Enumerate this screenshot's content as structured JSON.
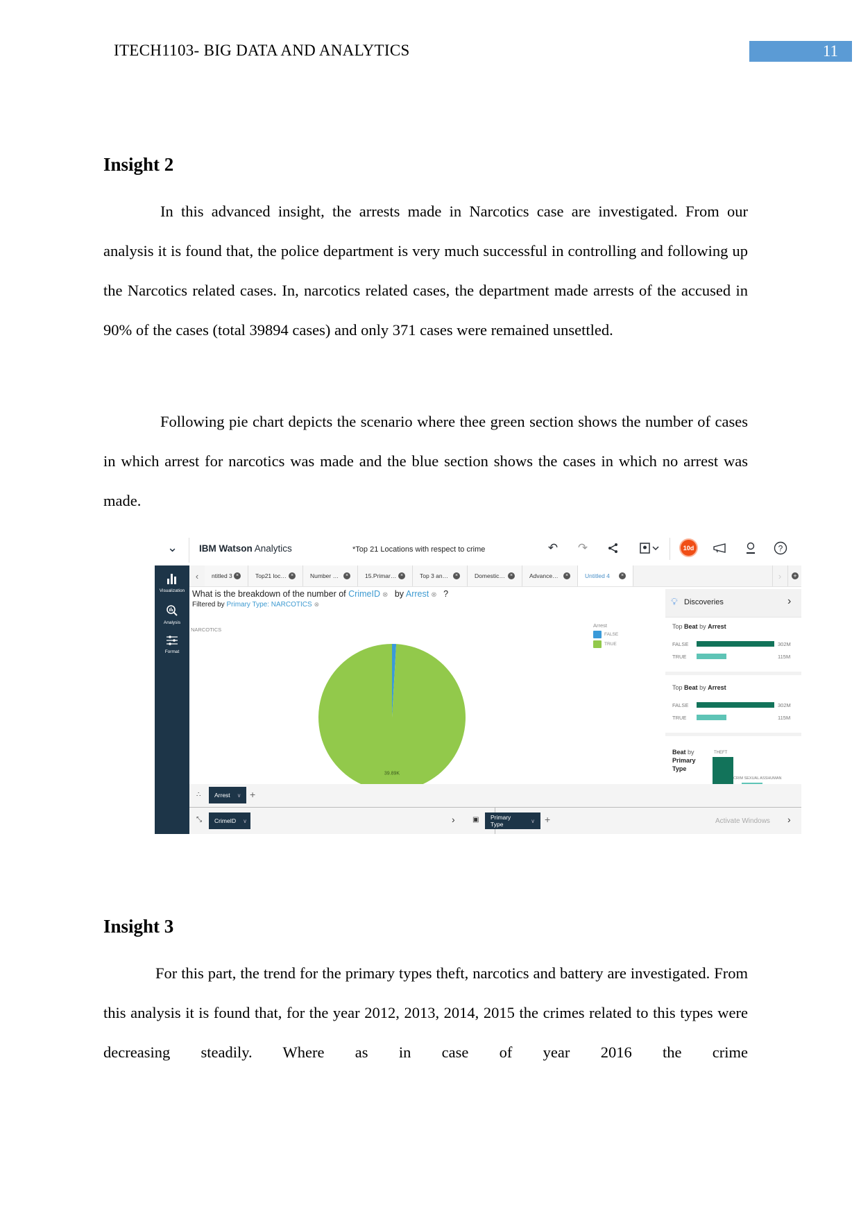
{
  "header": {
    "running_title": "ITECH1103- BIG DATA AND ANALYTICS",
    "page_number": "11"
  },
  "insight2": {
    "heading": "Insight 2",
    "paragraph1": "In this advanced insight, the arrests made in Narcotics case are investigated.   From our analysis it is found that, the police department is very much successful in controlling and following up the Narcotics related cases. In, narcotics related cases, the department made arrests of the accused in 90% of the cases (total 39894 cases) and only 371 cases were remained unsettled.",
    "paragraph2": "Following pie chart depicts the scenario where thee green section shows the number of cases in which arrest for narcotics was made and the blue section shows the cases in which no arrest was made."
  },
  "screenshot": {
    "topbar": {
      "menu_icon": "chevron-down-icon",
      "brand_bold": "IBM Watson",
      "brand_rest": " Analytics",
      "document_title": "*Top 21 Locations with respect to crime",
      "badge": "10d",
      "icons": [
        "undo-icon",
        "redo-icon",
        "share-icon",
        "screenshot-icon",
        "megaphone-icon",
        "user-icon",
        "help-icon"
      ]
    },
    "leftnav": [
      {
        "label": "Visualization",
        "icon": "bar-chart-icon"
      },
      {
        "label": "Analysis",
        "icon": "magnifier-chart-icon"
      },
      {
        "label": "Format",
        "icon": "sliders-icon"
      }
    ],
    "tabs": [
      {
        "label": "ntitled 3",
        "active": false
      },
      {
        "label": "Top21 loc…",
        "active": false
      },
      {
        "label": "Number …",
        "active": false
      },
      {
        "label": "15.Primar…",
        "active": false
      },
      {
        "label": "Top 3 an…",
        "active": false
      },
      {
        "label": "Domestic…",
        "active": false
      },
      {
        "label": "Advance…",
        "active": false
      },
      {
        "label": "Untitled 4",
        "active": true
      }
    ],
    "question": {
      "prefix": "What is the breakdown of the number of",
      "field1": "CrimeID",
      "by": "by",
      "field2": "Arrest",
      "suffix": "?"
    },
    "filter": {
      "prefix": "Filtered by",
      "value": "Primary Type: NARCOTICS"
    },
    "chart_label": "NARCOTICS",
    "legend": {
      "title": "Arrest",
      "items": [
        {
          "label": "FALSE",
          "color": "#3a9ad9"
        },
        {
          "label": "TRUE",
          "color": "#92c94b"
        }
      ]
    },
    "discoveries": {
      "title": "Discoveries",
      "cards": [
        {
          "title_pre": "Top",
          "title_b1": "Beat",
          "title_mid": "by",
          "title_b2": "Arrest",
          "rows": [
            {
              "label": "FALSE",
              "value": "302M",
              "frac": 1.0,
              "color": "#12735a"
            },
            {
              "label": "TRUE",
              "value": "115M",
              "frac": 0.38,
              "color": "#5ec4b6"
            }
          ]
        },
        {
          "title_pre": "Top",
          "title_b1": "Beat",
          "title_mid": "by",
          "title_b2": "Arrest",
          "rows": [
            {
              "label": "FALSE",
              "value": "302M",
              "frac": 1.0,
              "color": "#12735a"
            },
            {
              "label": "TRUE",
              "value": "115M",
              "frac": 0.38,
              "color": "#5ec4b6"
            }
          ]
        }
      ],
      "card3": {
        "title_b1": "Beat",
        "title_mid": "by",
        "title_b2": "Primary Type",
        "bars": [
          {
            "label": "THEFT",
            "color": "#12735a"
          },
          {
            "label": "CRIM SEXUAL ASS",
            "color": "#5ec4b6"
          },
          {
            "label": "HUMAN",
            "color": "#b5e3db"
          }
        ]
      }
    },
    "shelves": {
      "color_pill": "Arrest",
      "size_pill": "CrimeID",
      "repeat_pill": "Primary Type",
      "watermark": "Activate Windows"
    }
  },
  "chart_data": {
    "type": "pie",
    "title": "NARCOTICS",
    "legend_title": "Arrest",
    "legend_position": "top-right",
    "categories": [
      "FALSE",
      "TRUE"
    ],
    "values": [
      371,
      39894
    ],
    "colors": [
      "#3a9ad9",
      "#92c94b"
    ],
    "data_labels": [
      "",
      "39.89K"
    ]
  },
  "insight3": {
    "heading": "Insight 3",
    "paragraph1": "For this part, the trend for the primary types theft, narcotics and battery are investigated.  From this analysis it is found that, for the year 2012, 2013, 2014, 2015 the crimes related to this types were decreasing steadily. Where as in case of year 2016 the crime"
  }
}
